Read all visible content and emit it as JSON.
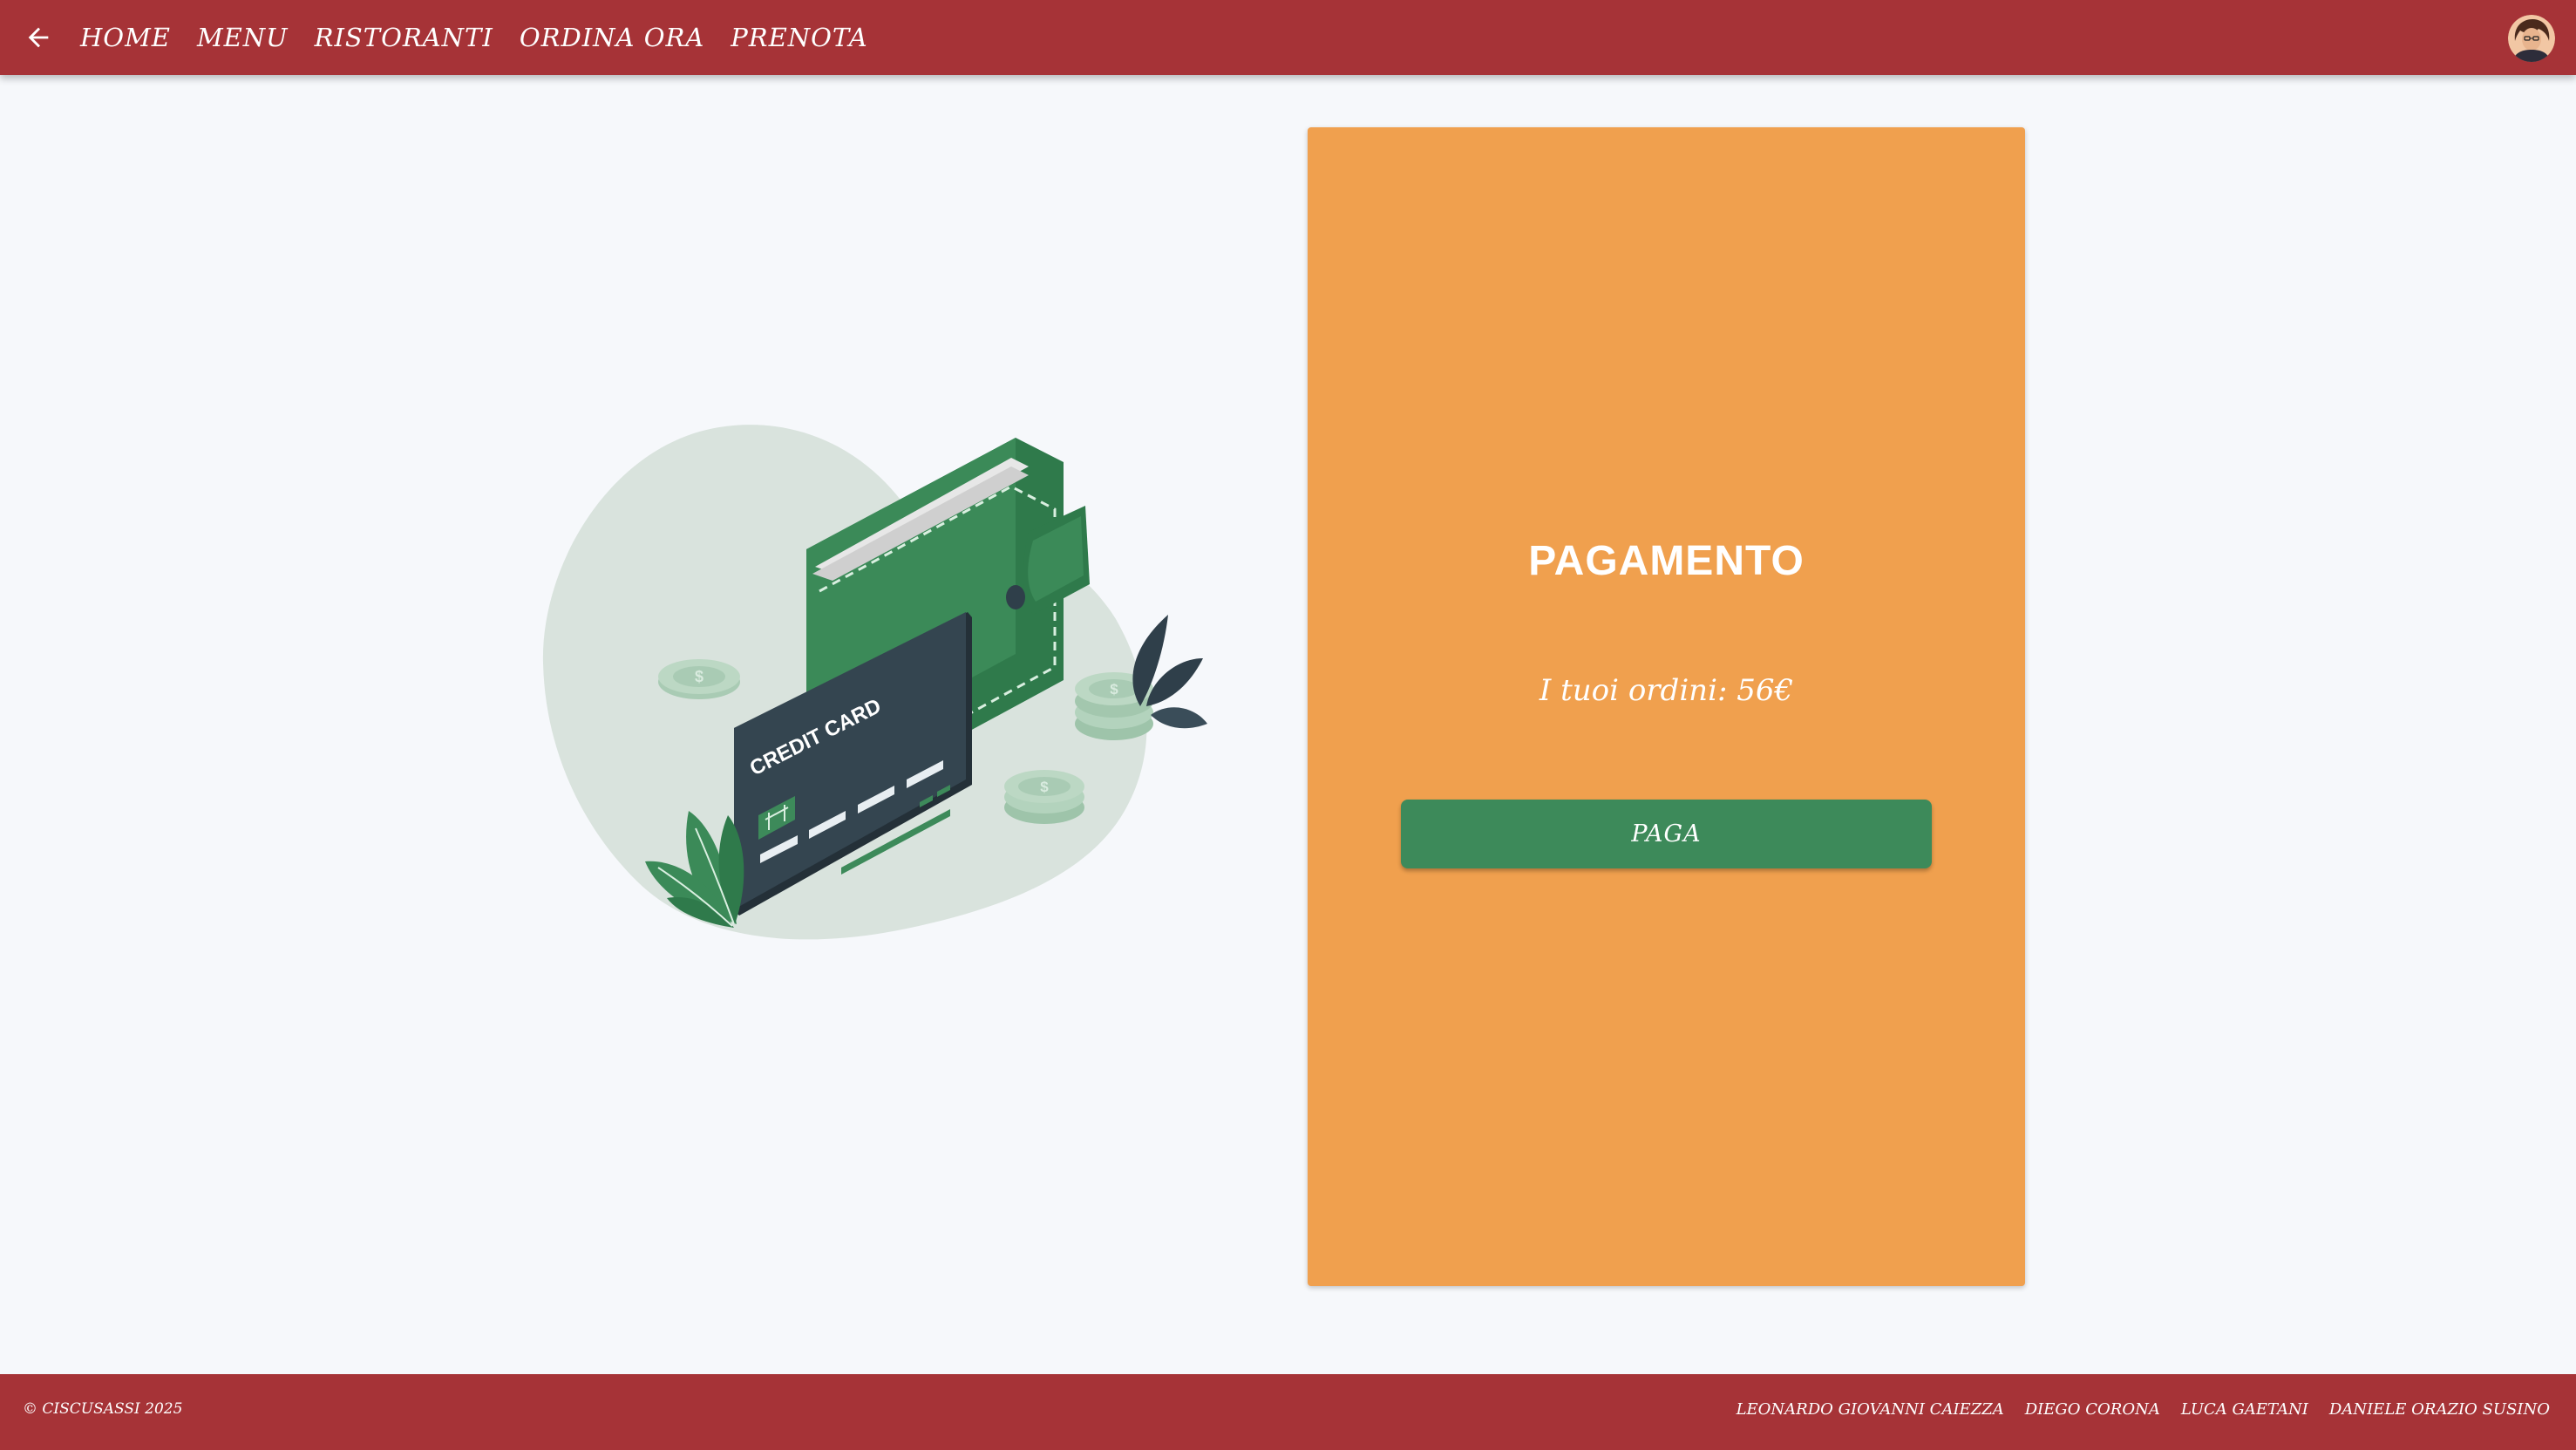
{
  "colors": {
    "brand_red": "#a63337",
    "page_background": "#f6f8fb",
    "card_orange": "#f0a04e",
    "button_green": "#3d8a5a",
    "text_white": "#ffffff"
  },
  "header": {
    "back_icon": "arrow-left-icon",
    "nav": [
      {
        "label": "HOME"
      },
      {
        "label": "MENU"
      },
      {
        "label": "RISTORANTI"
      },
      {
        "label": "ORDINA ORA"
      },
      {
        "label": "PRENOTA"
      }
    ],
    "avatar_icon": "user-avatar"
  },
  "illustration": {
    "card_text": "CREDIT CARD"
  },
  "payment": {
    "title": "PAGAMENTO",
    "orders_summary": "I tuoi ordini: 56€",
    "pay_button_label": "PAGA"
  },
  "footer": {
    "copyright": "© CISCUSASSI 2025",
    "authors": [
      "LEONARDO GIOVANNI CAIEZZA",
      "DIEGO CORONA",
      "LUCA GAETANI",
      "DANIELE ORAZIO SUSINO"
    ]
  }
}
